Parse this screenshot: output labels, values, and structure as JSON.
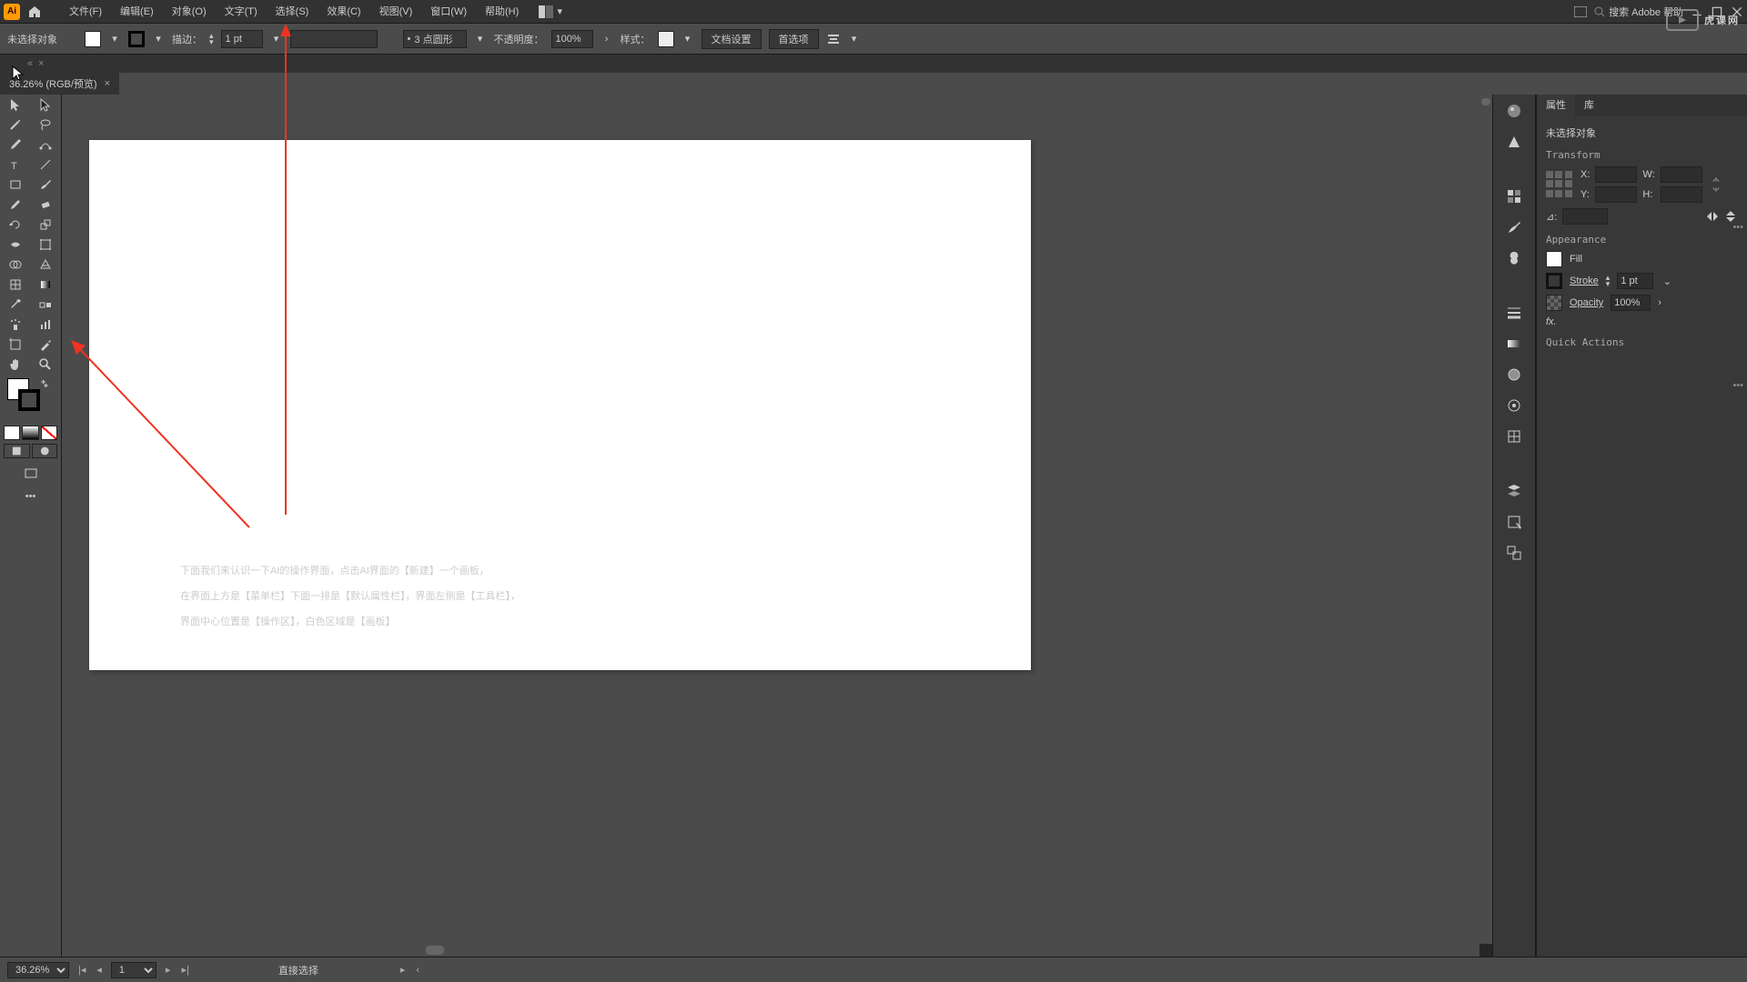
{
  "menubar": {
    "items": [
      "文件(F)",
      "编辑(E)",
      "对象(O)",
      "文字(T)",
      "选择(S)",
      "效果(C)",
      "视图(V)",
      "窗口(W)",
      "帮助(H)"
    ],
    "search_placeholder": "搜索 Adobe 帮助"
  },
  "controlbar": {
    "no_selection": "未选择对象",
    "stroke_label": "描边：",
    "stroke_value": "1 pt",
    "brush_value": "3 点圆形",
    "opacity_label": "不透明度：",
    "opacity_value": "100%",
    "style_label": "样式：",
    "doc_setup": "文档设置",
    "preferences": "首选项"
  },
  "document": {
    "tab_title": "36.26% (RGB/预览)"
  },
  "properties": {
    "tabs": [
      "属性",
      "库"
    ],
    "no_selection": "未选择对象",
    "transform_title": "Transform",
    "x_label": "X:",
    "y_label": "Y:",
    "w_label": "W:",
    "h_label": "H:",
    "angle_label": "⊿:",
    "appearance_title": "Appearance",
    "fill_label": "Fill",
    "stroke_label": "Stroke",
    "stroke_val": "1 pt",
    "opacity_label": "Opacity",
    "opacity_val": "100%",
    "fx_label": "fx.",
    "quick_actions": "Quick Actions"
  },
  "statusbar": {
    "zoom": "36.26%",
    "artboard": "1",
    "tool_hint": "直接选择"
  },
  "annotation": {
    "line1": "下面我们来认识一下AI的操作界面，点击AI界面的【新建】一个画板，",
    "line2": "在界面上方是【菜单栏】下面一排是【默认属性栏】，界面左侧是【工具栏】，",
    "line3": "界面中心位置是【操作区】，白色区域是【画板】"
  },
  "watermark": {
    "text": "虎课网"
  }
}
